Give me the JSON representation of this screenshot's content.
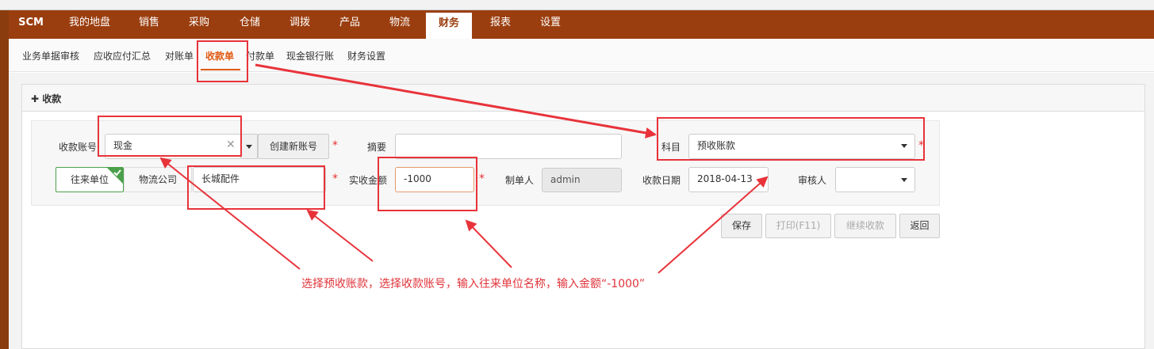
{
  "nav": {
    "brand": "SCM",
    "items": [
      "我的地盘",
      "销售",
      "采购",
      "仓储",
      "调拨",
      "产品",
      "物流",
      "财务",
      "报表",
      "设置"
    ],
    "active": "财务"
  },
  "subnav": {
    "items": [
      "业务单据审核",
      "应收应付汇总",
      "对账单",
      "收款单",
      "付款单",
      "现金银行账",
      "财务设置"
    ],
    "active": "收款单"
  },
  "panel": {
    "title": "收款"
  },
  "form": {
    "account_label": "收款账号",
    "account_value": "现金",
    "create_account_button": "创建新账号",
    "summary_label": "摘要",
    "summary_value": "",
    "subject_label": "科目",
    "subject_value": "预收账款",
    "partner_toggle": "往来单位",
    "partner_type": "物流公司",
    "partner_value": "长城配件",
    "amount_label": "实收金额",
    "amount_value": "-1000",
    "maker_label": "制单人",
    "maker_value": "admin",
    "date_label": "收款日期",
    "date_value": "2018-04-13",
    "reviewer_label": "审核人",
    "reviewer_value": ""
  },
  "actions": {
    "save": "保存",
    "print": "打印(F11)",
    "continue": "继续收款",
    "back": "返回"
  },
  "annotation": {
    "text": "选择预收账款，选择收款账号，输入往来单位名称，输入金额“-1000”",
    "color": "#e8333a"
  },
  "colors": {
    "nav_bg": "#9b3e0f",
    "accent": "#e05a12",
    "success": "#4aa04a"
  }
}
